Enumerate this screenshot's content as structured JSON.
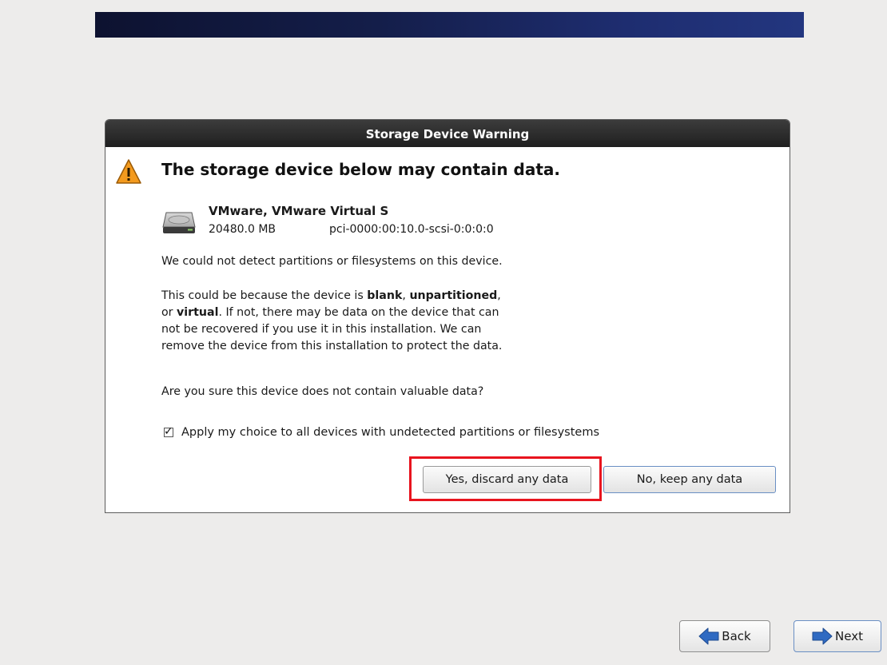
{
  "dialog": {
    "title": "Storage Device Warning",
    "heading": "The storage device below may contain data.",
    "device": {
      "name": "VMware, VMware Virtual S",
      "size": "20480.0 MB",
      "path": "pci-0000:00:10.0-scsi-0:0:0:0"
    },
    "paragraph1": "We could not detect partitions or filesystems on this device.",
    "paragraph2": {
      "line1_pre": "This could be because the device is ",
      "line1_blank": "blank",
      "line1_sep": ", ",
      "line1_unpartitioned": "unpartitioned",
      "line1_post": ",",
      "line2_pre": "or ",
      "line2_virtual": "virtual",
      "line2_post": ". If not, there may be data on the device that can",
      "line3": "not be recovered if you use it in this installation. We can",
      "line4": "remove the device from this installation to protect the data."
    },
    "question": "Are you sure this device does not contain valuable data?",
    "apply_all_label": "Apply my choice to all devices with undetected partitions or filesystems",
    "apply_all_checked": true,
    "yes_button": "Yes, discard any data",
    "no_button": "No, keep any data"
  },
  "nav": {
    "back_label": "Back",
    "next_label": "Next"
  },
  "colors": {
    "highlight": "#e8141e",
    "banner": "#141e4a",
    "arrow": "#2f6ac2",
    "warning": "#f39a1e"
  },
  "icons": {
    "warning": "warning-icon",
    "disk": "hard-disk-icon",
    "back": "arrow-left-icon",
    "next": "arrow-right-icon",
    "checkbox": "checkmark-icon"
  }
}
